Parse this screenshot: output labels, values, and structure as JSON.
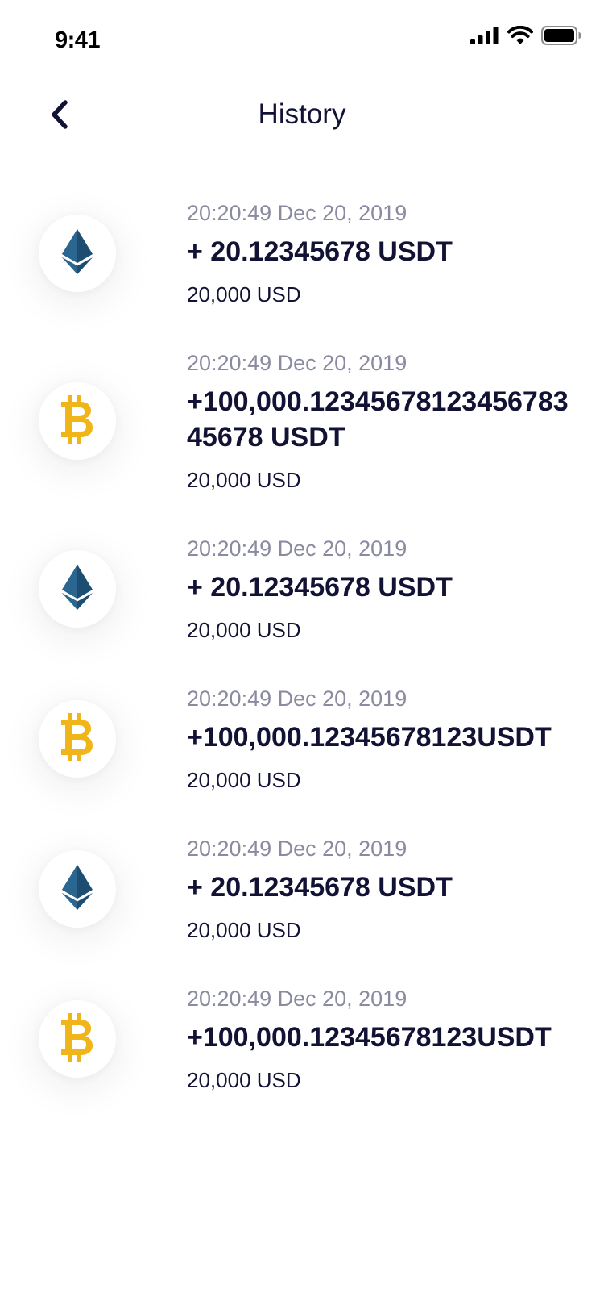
{
  "status_bar": {
    "time": "9:41",
    "icons": [
      "cellular-signal-icon",
      "wifi-icon",
      "battery-icon"
    ]
  },
  "header": {
    "title": "History",
    "back_icon": "chevron-left-icon"
  },
  "colors": {
    "text_primary": "#121235",
    "text_secondary": "#8a8aa0",
    "eth": "#1d4e72",
    "btc": "#f0b519"
  },
  "history": [
    {
      "coin": "ethereum-icon",
      "time": "20:20:49 Dec 20, 2019",
      "amount": "+ 20.12345678 USDT",
      "fiat": "20,000 USD"
    },
    {
      "coin": "bitcoin-icon",
      "time": "20:20:49 Dec 20, 2019",
      "amount": "+100,000.1234567812345678345678 USDT",
      "fiat": "20,000 USD"
    },
    {
      "coin": "ethereum-icon",
      "time": "20:20:49 Dec 20, 2019",
      "amount": "+ 20.12345678 USDT",
      "fiat": "20,000 USD"
    },
    {
      "coin": "bitcoin-icon",
      "time": "20:20:49 Dec 20, 2019",
      "amount": "+100,000.12345678123USDT",
      "fiat": "20,000 USD"
    },
    {
      "coin": "ethereum-icon",
      "time": "20:20:49 Dec 20, 2019",
      "amount": "+ 20.12345678 USDT",
      "fiat": "20,000 USD"
    },
    {
      "coin": "bitcoin-icon",
      "time": "20:20:49 Dec 20, 2019",
      "amount": "+100,000.12345678123USDT",
      "fiat": "20,000 USD"
    }
  ]
}
